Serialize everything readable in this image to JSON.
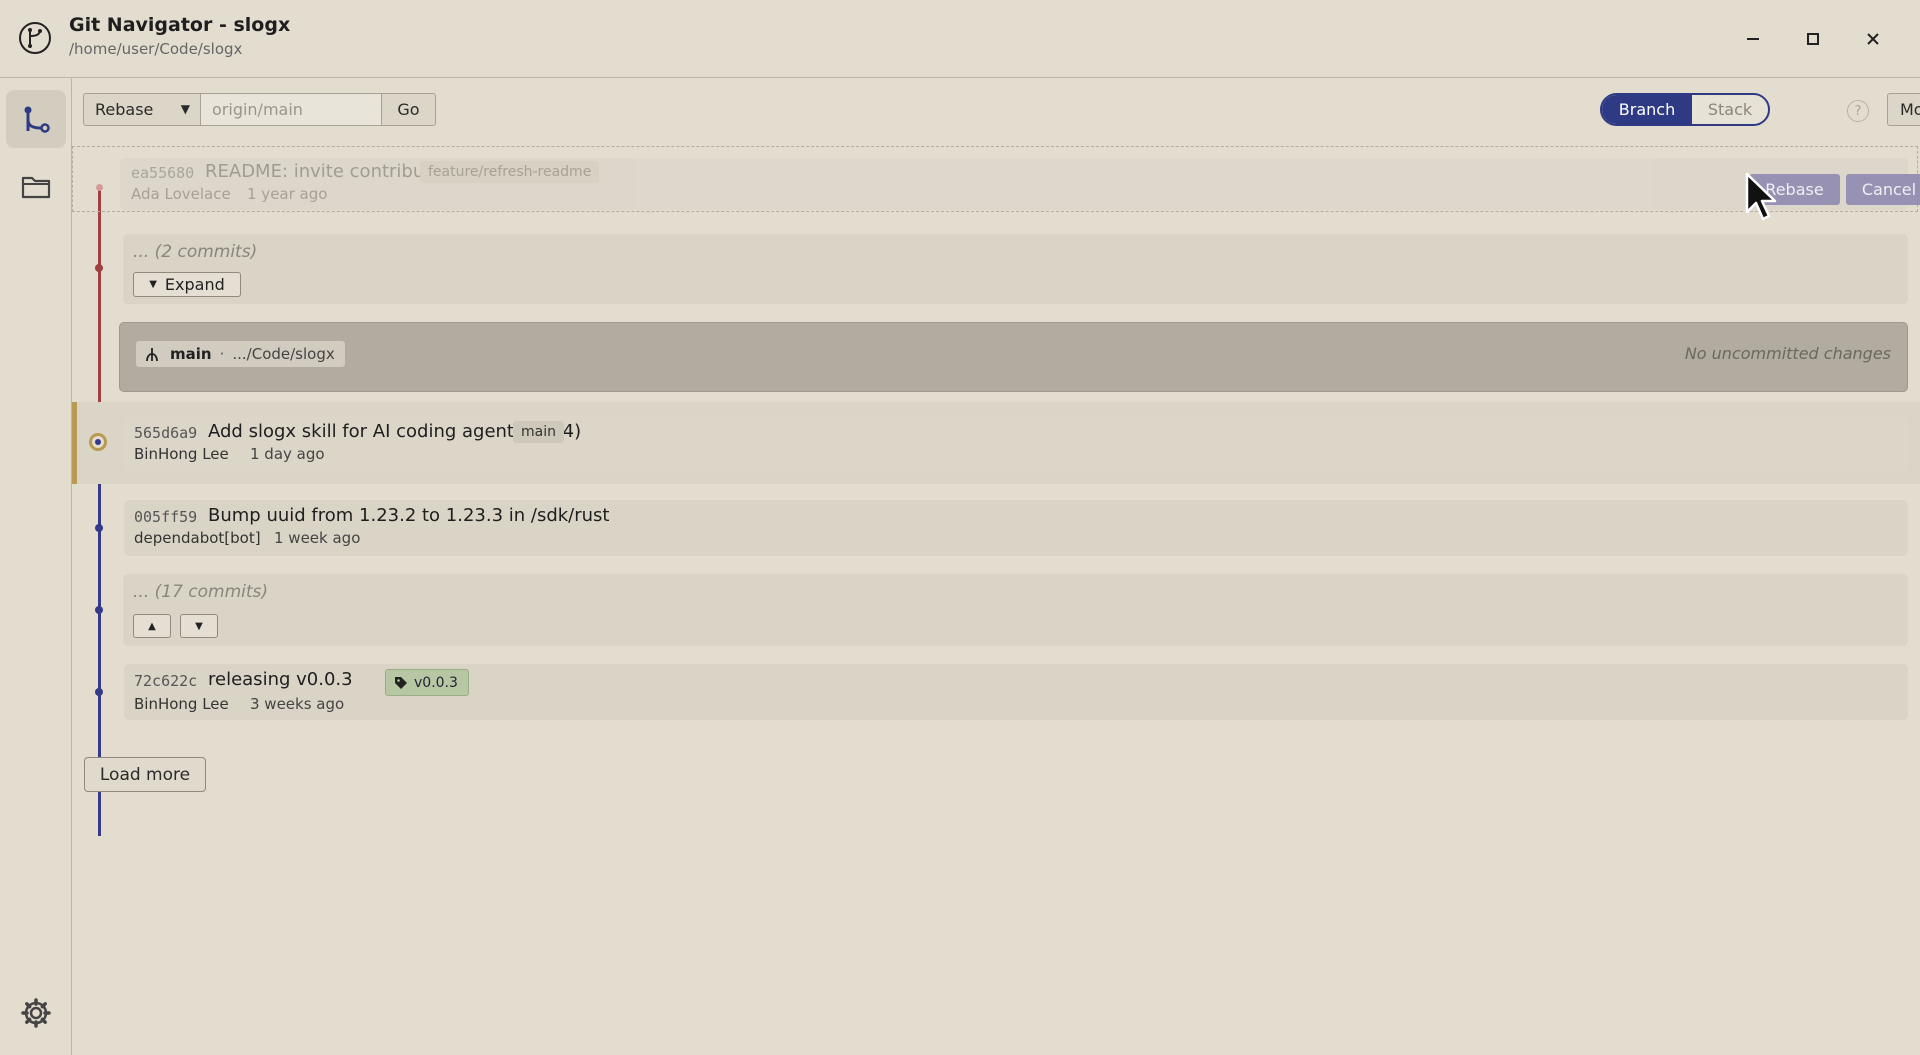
{
  "window": {
    "title": "Git Navigator - slogx",
    "path": "/home/user/Code/slogx"
  },
  "toolbar": {
    "mode": "Rebase",
    "target_placeholder": "origin/main",
    "go_label": "Go",
    "view_branch": "Branch",
    "view_stack": "Stack",
    "help": "?",
    "more_label": "More"
  },
  "dragged_commit": {
    "sha": "ea55680",
    "message": "README: invite contributors",
    "ref": "feature/refresh-readme",
    "author": "Ada Lovelace",
    "ago": "1 year ago",
    "rebase_label": "Rebase",
    "cancel_label": "Cancel"
  },
  "collapsed_top": {
    "text": "... (2 commits)",
    "expand_label": "Expand"
  },
  "worktree": {
    "branch": "main",
    "separator": "·",
    "path": ".../Code/slogx",
    "status": "No uncommitted changes"
  },
  "commits": [
    {
      "sha": "565d6a9",
      "message": "Add slogx skill for AI coding agents (#94)",
      "ref": "main",
      "author": "BinHong Lee",
      "ago": "1 day ago"
    },
    {
      "sha": "005ff59",
      "message": "Bump uuid from 1.23.2 to 1.23.3 in /sdk/rust",
      "author": "dependabot[bot]",
      "ago": "1 week ago"
    },
    {
      "sha": "72c622c",
      "message": "releasing v0.0.3",
      "tag": "v0.0.3",
      "author": "BinHong Lee",
      "ago": "3 weeks ago"
    }
  ],
  "collapsed_bottom": {
    "text": "... (17 commits)"
  },
  "load_more_label": "Load more",
  "colors": {
    "accent": "#2f3a85",
    "branch_line": "#a04040",
    "main_line": "#34398a",
    "head_highlight": "#b89a50",
    "tag_bg": "#b7c7a3"
  }
}
